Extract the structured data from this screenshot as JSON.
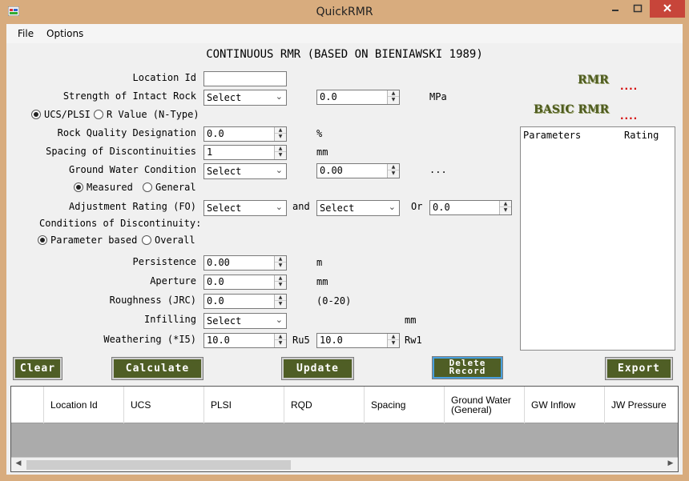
{
  "window": {
    "title": "QuickRMR"
  },
  "menu": [
    "File",
    "Options"
  ],
  "form_title": "CONTINUOUS RMR (BASED ON BIENIAWSKI 1989)",
  "fields": {
    "location_id": {
      "label": "Location Id",
      "value": ""
    },
    "intact_rock": {
      "label": "Strength of Intact Rock",
      "select": "Select",
      "value": "0.0",
      "unit": "MPa"
    },
    "ucs_radio": {
      "label": "UCS/PLSI",
      "checked": true
    },
    "rvalue_radio": {
      "label": "R Value (N-Type)",
      "checked": false
    },
    "rqd": {
      "label": "Rock Quality Designation",
      "value": "0.0",
      "unit": "%"
    },
    "spacing": {
      "label": "Spacing of Discontinuities",
      "value": "1",
      "unit": "mm"
    },
    "ground_water": {
      "label": "Ground Water Condition",
      "select": "Select",
      "value": "0.00",
      "extra": "..."
    },
    "measured_radio": {
      "label": "Measured",
      "checked": true
    },
    "general_radio": {
      "label": "General",
      "checked": false
    },
    "adjustment": {
      "label": "Adjustment Rating (FO)",
      "select1": "Select",
      "and": "and",
      "select2": "Select",
      "or": "Or",
      "value": "0.0"
    },
    "conditions": {
      "label": "Conditions of Discontinuity:"
    },
    "param_radio": {
      "label": "Parameter based",
      "checked": true
    },
    "overall_radio": {
      "label": "Overall",
      "checked": false
    },
    "persistence": {
      "label": "Persistence",
      "value": "0.00",
      "unit": "m"
    },
    "aperture": {
      "label": "Aperture",
      "value": "0.0",
      "unit": "mm"
    },
    "roughness": {
      "label": "Roughness (JRC)",
      "value": "0.0",
      "unit": "(0-20)"
    },
    "infilling": {
      "label": "Infilling",
      "select": "Select",
      "unit": "mm"
    },
    "weathering": {
      "label": "Weathering (*I5)",
      "value": "10.0",
      "unit1": "Ru5",
      "value2": "10.0",
      "unit2": "Rw1"
    }
  },
  "results": {
    "rmr_label": "RMR",
    "rmr_value": "....",
    "basic_label": "BASIC RMR",
    "basic_value": "....",
    "params_header": "Parameters",
    "rating_header": "Rating"
  },
  "buttons": {
    "clear": "Clear",
    "calculate": "Calculate",
    "update": "Update",
    "delete_line1": "Delete",
    "delete_line2": "Record",
    "export": "Export"
  },
  "grid": {
    "columns": [
      "Location Id",
      "UCS",
      "PLSI",
      "RQD",
      "Spacing",
      "Ground Water (General)",
      "GW Inflow",
      "JW Pressure"
    ]
  },
  "colors": {
    "accent_button": "#4f5e25",
    "rmr_text": "#4e5b1f",
    "rmr_value": "#d40000",
    "close_button": "#c7453a"
  }
}
